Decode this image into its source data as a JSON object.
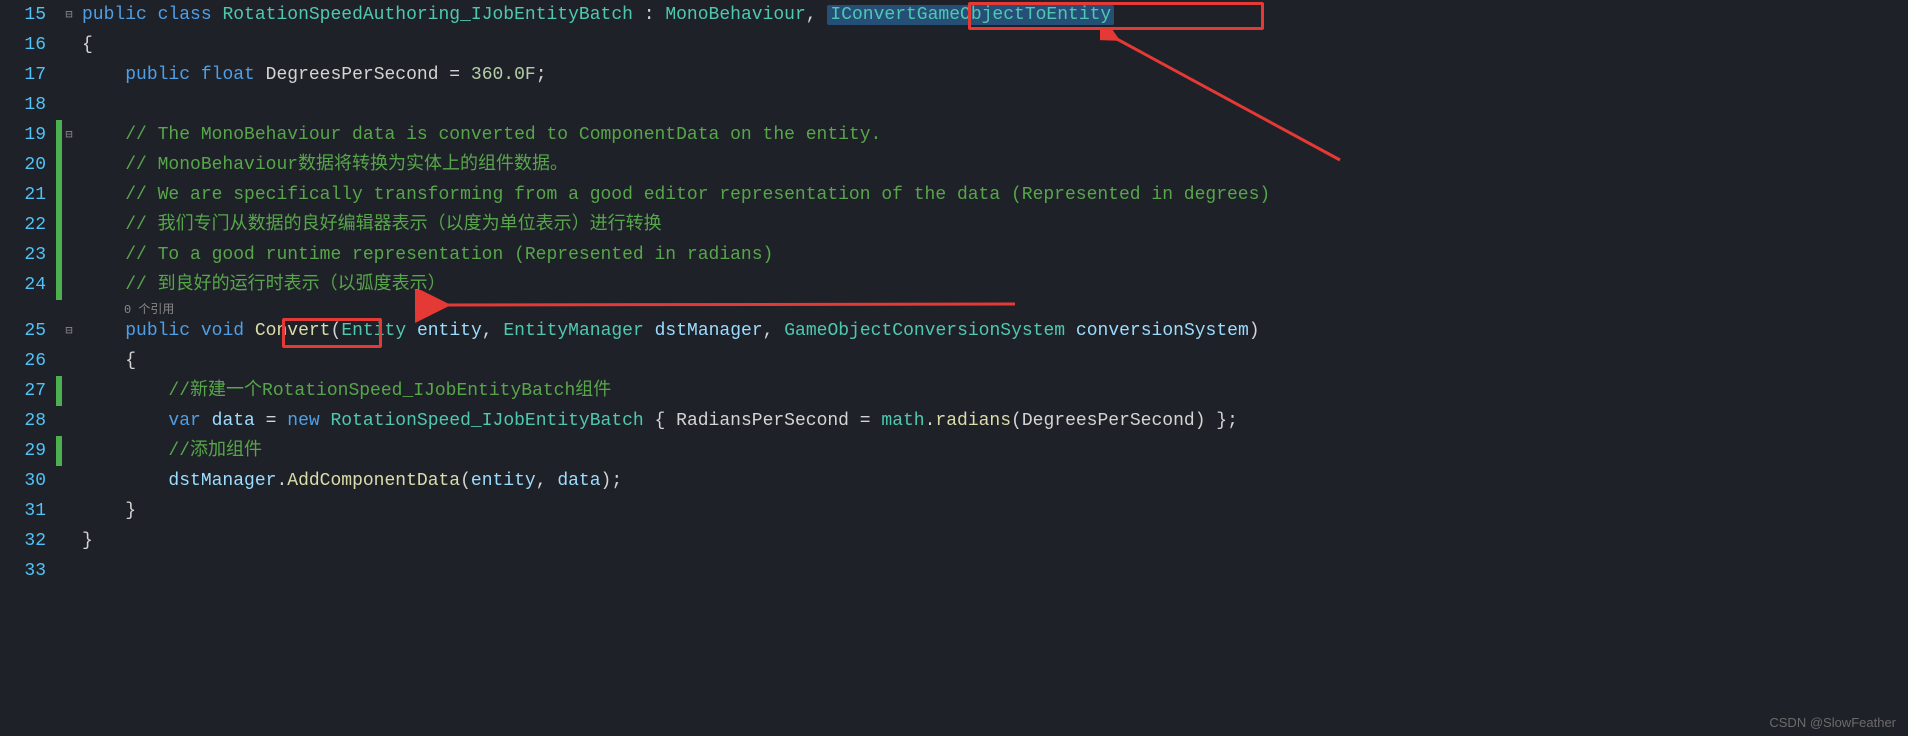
{
  "line_numbers": [
    "15",
    "16",
    "17",
    "18",
    "19",
    "20",
    "21",
    "22",
    "23",
    "24",
    "25",
    "26",
    "27",
    "28",
    "29",
    "30",
    "31",
    "32",
    "33"
  ],
  "codelens": "0 个引用",
  "l15": {
    "kw_public": "public",
    "kw_class": "class",
    "class_name": "RotationSpeedAuthoring_IJobEntityBatch",
    "colon": " : ",
    "base1": "MonoBehaviour",
    "comma": ",",
    "base2": "IConvertGameObjectToEntity"
  },
  "l16": {
    "brace": "{"
  },
  "l17": {
    "kw_public": "public",
    "type": "float",
    "name": "DegreesPerSecond",
    "eq": " = ",
    "val": "360.0F",
    "semi": ";"
  },
  "l19": {
    "cmt": "// The MonoBehaviour data is converted to ComponentData on the entity."
  },
  "l20": {
    "cmt": "// MonoBehaviour数据将转换为实体上的组件数据。"
  },
  "l21": {
    "cmt": "// We are specifically transforming from a good editor representation of the data (Represented in degrees)"
  },
  "l22": {
    "cmt": "// 我们专门从数据的良好编辑器表示（以度为单位表示）进行转换"
  },
  "l23": {
    "cmt": "// To a good runtime representation (Represented in radians)"
  },
  "l24": {
    "cmt": "// 到良好的运行时表示（以弧度表示）"
  },
  "l25": {
    "kw_public": "public",
    "kw_void": "void",
    "method": "Convert",
    "p1t": "Entity",
    "p1n": "entity",
    "p2t": "EntityManager",
    "p2n": "dstManager",
    "p3t": "GameObjectConversionSystem",
    "p3n": "conversionSystem"
  },
  "l26": {
    "brace": "{"
  },
  "l27": {
    "cmt": "//新建一个RotationSpeed_IJobEntityBatch组件"
  },
  "l28": {
    "kw_var": "var",
    "name": "data",
    "eq": " = ",
    "kw_new": "new",
    "type": "RotationSpeed_IJobEntityBatch",
    "ob": " { ",
    "prop": "RadiansPerSecond",
    "eq2": " = ",
    "mathcls": "math",
    "dot": ".",
    "radians": "radians",
    "arg": "DegreesPerSecond",
    "cb": " };"
  },
  "l29": {
    "cmt": "//添加组件"
  },
  "l30": {
    "obj": "dstManager",
    "dot": ".",
    "method": "AddComponentData",
    "a1": "entity",
    "a2": "data"
  },
  "l31": {
    "brace": "}"
  },
  "l32": {
    "brace": "}"
  },
  "watermark": "CSDN @SlowFeather"
}
